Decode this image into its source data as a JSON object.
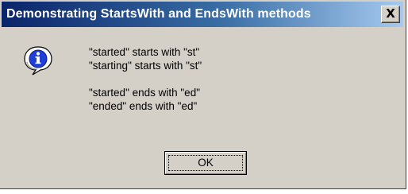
{
  "dialog": {
    "title": "Demonstrating StartsWith and EndsWith methods",
    "close_label": "X",
    "icon": "information-icon",
    "message_lines": [
      "\"started\" starts with \"st\"",
      "\"starting\" starts with \"st\"",
      "\"started\" ends with \"ed\"",
      "\"ended\" ends with \"ed\""
    ],
    "ok_label": "OK"
  },
  "colors": {
    "titlebar_start": "#0a246a",
    "titlebar_end": "#a6caf0",
    "dialog_face": "#d4d0c8"
  }
}
